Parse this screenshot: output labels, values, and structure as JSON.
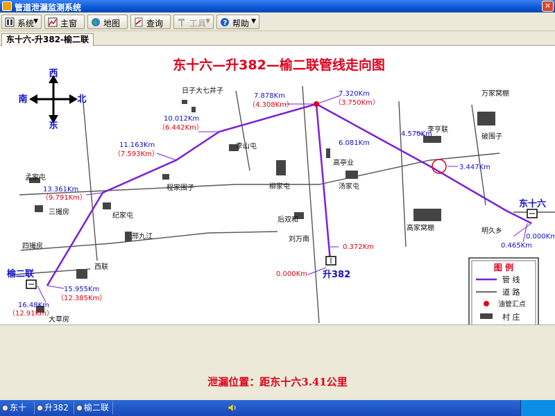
{
  "window": {
    "title": "管道泄漏监测系统",
    "close_label": "✕"
  },
  "toolbar": {
    "system": "系统",
    "main": "主窗",
    "map": "地图",
    "query": "查询",
    "tools": "工具",
    "help": "帮助"
  },
  "tab": {
    "label": "东十六-升382-榆二联"
  },
  "map": {
    "title": "东十六—升382—榆二联管线走向图",
    "compass": {
      "west": "西",
      "south": "南",
      "north": "北",
      "east": "东"
    },
    "stations": {
      "dong16": "东十六",
      "sheng382": "升382",
      "yu2lian": "榆二联"
    },
    "villages": {
      "rizi": "日子大七井子",
      "lishantun": "李山屯",
      "chengjiawaizi": "程家围子",
      "liujiatun": "柳家屯",
      "houshuanghe": "后双和",
      "liuwannan": "刘万南",
      "gaoxiangye": "高亭业",
      "tangjiatun": "汤家屯",
      "lihengjia": "李亨联",
      "powaizi": "破围子",
      "wanjiaopeng": "万家窝棚",
      "gaojiaopeng": "高家窝棚",
      "mingjiuxiang": "明久乡",
      "mengjiatun": "孟家屯",
      "sanxiaofang": "三撮房",
      "jijiatun": "纪家屯",
      "bangjiujiang": "邢九江",
      "sixiaofang": "四撮房",
      "xilian": "西联",
      "dacaofang": "大草房"
    },
    "distances": {
      "d0000_dong": "0.000Km",
      "d0465": "0.465Km",
      "d3447": "3.447Km",
      "d4570": "4.570Km",
      "d6081": "6.081Km",
      "d7320": "7.320Km",
      "d3750": "（3.750Km）",
      "d7878": "7.878Km",
      "d4308": "（4.308Km）",
      "d10012": "10.012Km",
      "d6442": "（6.442Km）",
      "d11163": "11.163Km",
      "d7593": "（7.593Km）",
      "d13361": "13.361Km",
      "d9791": "（9.791Km）",
      "d15955": "15.955Km",
      "d12385": "（12.385Km）",
      "d1648": "16.48Km",
      "d1291": "（12.91Km）",
      "d0372": "0.372Km",
      "d0000_sheng": "0.000Km"
    },
    "legend": {
      "title": "图 例",
      "pipeline": "管 线",
      "road": "道 路",
      "junction": "油管汇点",
      "village": "村 庄"
    },
    "colors": {
      "pipeline": "#7b1fd6",
      "distance_blue": "#1010c8",
      "distance_red": "#e00010",
      "title_red": "#e0001c"
    }
  },
  "leak_text": "泄漏位置：距东十六3.41公里",
  "statusbar": {
    "tasks": [
      "东十六",
      "升382",
      "榆二联"
    ]
  }
}
